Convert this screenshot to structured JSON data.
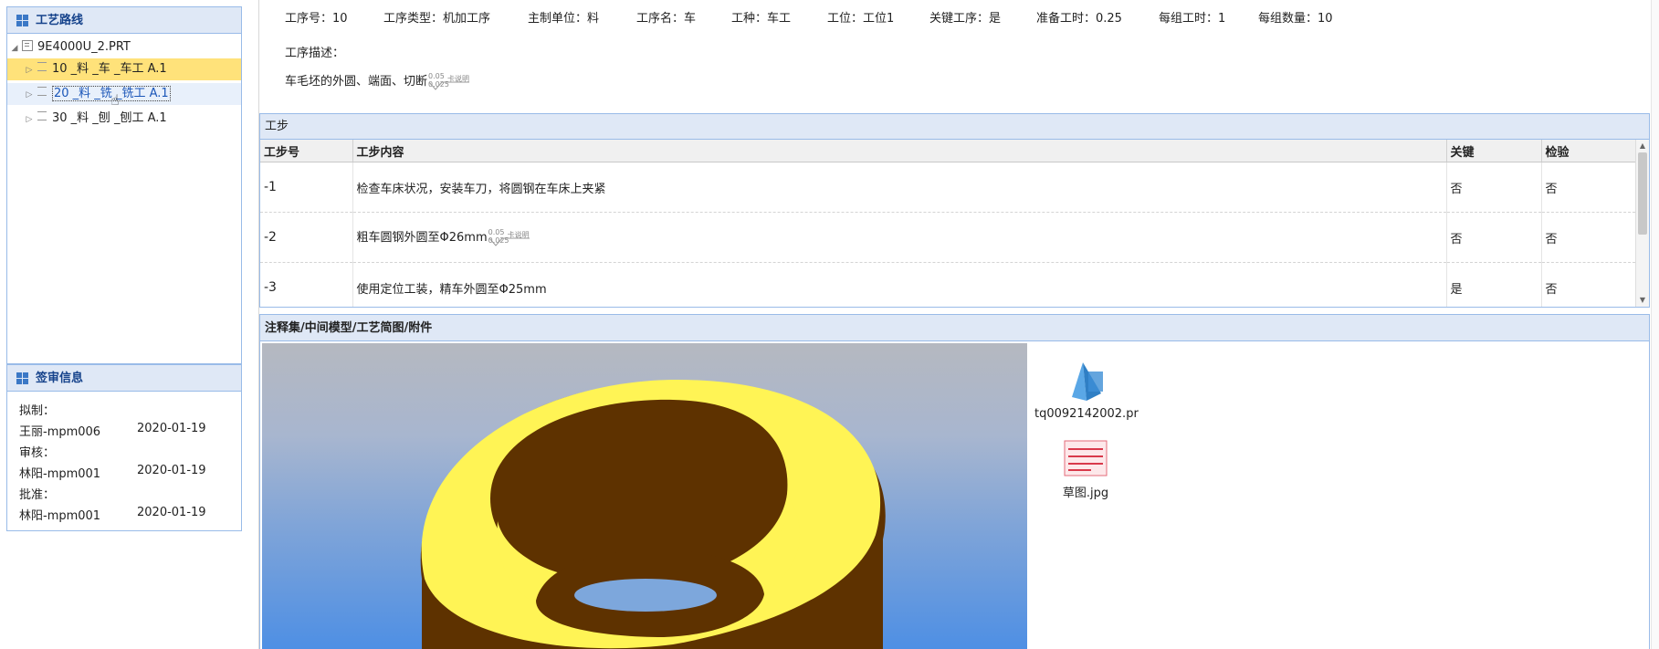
{
  "route": {
    "title": "工艺路线",
    "root": "9E4000U_2.PRT",
    "items": [
      {
        "label": "10 _料 _车 _车工 A.1"
      },
      {
        "label": "20 _料 _铣 _铣工 A.1"
      },
      {
        "label": "30 _料 _刨 _刨工 A.1"
      }
    ]
  },
  "signoff": {
    "title": "签审信息",
    "draft_label": "拟制：",
    "draft_name": "王丽-mpm006",
    "draft_date": "2020-01-19",
    "review_label": "审核：",
    "review_name": "林阳-mpm001",
    "review_date": "2020-01-19",
    "approve_label": "批准：",
    "approve_name": "林阳-mpm001",
    "approve_date": "2020-01-19"
  },
  "operation": {
    "fields": [
      "工序号：10",
      "工序类型：机加工序",
      "主制单位：料",
      "工序名：车",
      "工种：车工",
      "工位：工位1",
      "关键工序：是",
      "准备工时：0.25",
      "每组工时：1",
      "每组数量：10"
    ],
    "desc_label": "工序描述：",
    "desc": "车毛坯的外圆、端面、切断",
    "tol_upper": "0.05",
    "tol_lower": "0.025",
    "tol_note": "卡说明"
  },
  "steps": {
    "title": "工步",
    "headers": [
      "工步号",
      "工步内容",
      "关键",
      "检验"
    ],
    "rows": [
      {
        "no": "-1",
        "content": "检查车床状况，安装车刀，将圆钢在车床上夹紧",
        "key": "否",
        "check": "否"
      },
      {
        "no": "-2",
        "content": "粗车圆钢外圆至Φ26mm",
        "key": "否",
        "check": "否"
      },
      {
        "no": "-3",
        "content": "使用定位工装，精车外圆至Φ25mm",
        "key": "是",
        "check": "否"
      }
    ]
  },
  "attachments": {
    "title": "注释集/中间模型/工艺简图/附件",
    "files": [
      {
        "name": "tq0092142002.pr",
        "icon": "3d-model-icon"
      },
      {
        "name": "草图.jpg",
        "icon": "image-file-icon"
      }
    ]
  }
}
